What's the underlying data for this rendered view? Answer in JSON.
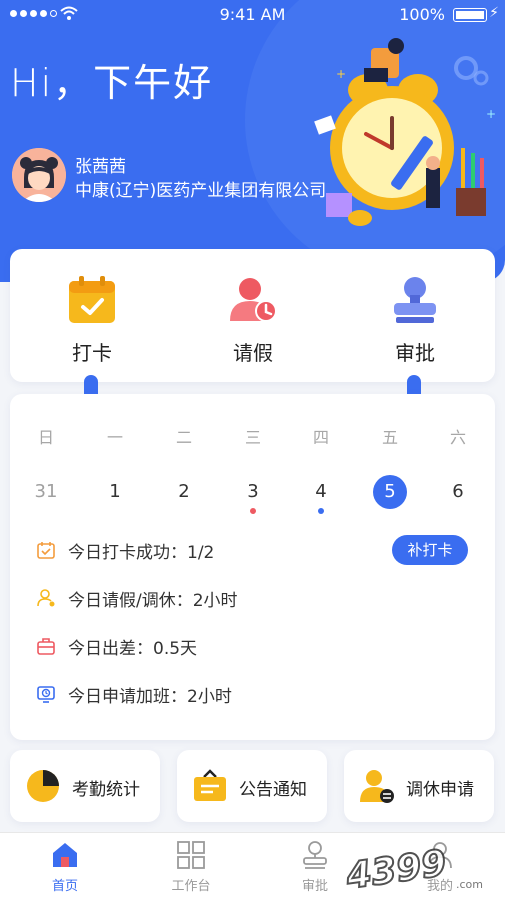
{
  "status_bar": {
    "time": "9:41 AM",
    "battery": "100%"
  },
  "greeting": "Hi，下午好",
  "user": {
    "name": "张茜茜",
    "company": "中康(辽宁)医药产业集团有限公司"
  },
  "quick_actions": [
    {
      "label": "打卡",
      "icon": "calendar-check-icon"
    },
    {
      "label": "请假",
      "icon": "person-clock-icon"
    },
    {
      "label": "审批",
      "icon": "stamp-icon"
    }
  ],
  "calendar": {
    "weekdays": [
      "日",
      "一",
      "二",
      "三",
      "四",
      "五",
      "六"
    ],
    "dates": [
      "31",
      "1",
      "2",
      "3",
      "4",
      "5",
      "6"
    ],
    "selected": "5"
  },
  "stats": {
    "checkin": "今日打卡成功：1/2",
    "leave": "今日请假/调休：2小时",
    "trip": "今日出差：0.5天",
    "overtime": "今日申请加班：2小时",
    "supplement_button": "补打卡"
  },
  "features": [
    {
      "label": "考勤统计",
      "icon": "pie-chart-icon"
    },
    {
      "label": "公告通知",
      "icon": "briefcase-notice-icon"
    },
    {
      "label": "调休申请",
      "icon": "person-swap-icon"
    }
  ],
  "tabs": [
    {
      "label": "首页",
      "icon": "home-icon"
    },
    {
      "label": "工作台",
      "icon": "grid-icon"
    },
    {
      "label": "审批",
      "icon": "stamp-icon"
    },
    {
      "label": "我的",
      "icon": "user-icon"
    }
  ],
  "watermark": "4399.com",
  "colors": {
    "primary": "#3a6df0",
    "accent_yellow": "#f6b81c",
    "accent_red": "#ee5a62"
  }
}
